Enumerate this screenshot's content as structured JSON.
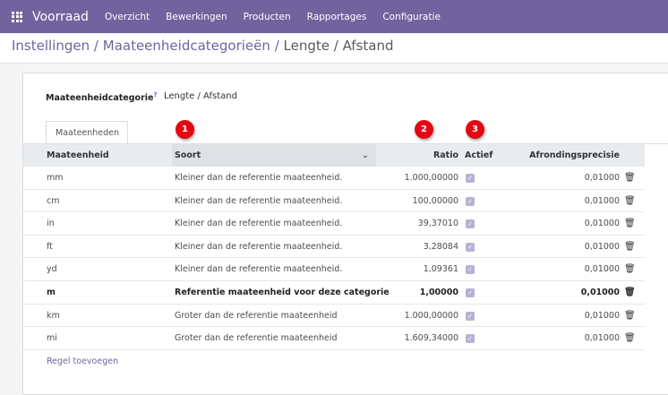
{
  "nav": {
    "brand": "Voorraad",
    "items": [
      "Overzicht",
      "Bewerkingen",
      "Producten",
      "Rapportages",
      "Configuratie"
    ]
  },
  "breadcrumb": {
    "items": [
      "Instellingen",
      "Maateenheidcategorieën"
    ],
    "current": "Lengte / Afstand",
    "separator": "/"
  },
  "form": {
    "category_label": "Maateenheidcategorie",
    "help": "?",
    "category_value": "Lengte / Afstand",
    "tab": "Maateenheden"
  },
  "table": {
    "headers": [
      "Maateenheid",
      "Soort",
      "Ratio",
      "Actief",
      "Afrondingsprecisie"
    ],
    "rows": [
      {
        "unit": "mm",
        "type": "Kleiner dan de referentie maateenheid.",
        "ratio": "1.000,00000",
        "rounding": "0,01000"
      },
      {
        "unit": "cm",
        "type": "Kleiner dan de referentie maateenheid.",
        "ratio": "100,00000",
        "rounding": "0,01000"
      },
      {
        "unit": "in",
        "type": "Kleiner dan de referentie maateenheid.",
        "ratio": "39,37010",
        "rounding": "0,01000"
      },
      {
        "unit": "ft",
        "type": "Kleiner dan de referentie maateenheid.",
        "ratio": "3,28084",
        "rounding": "0,01000"
      },
      {
        "unit": "yd",
        "type": "Kleiner dan de referentie maateenheid.",
        "ratio": "1,09361",
        "rounding": "0,01000"
      },
      {
        "unit": "m",
        "type": "Referentie maateenheid voor deze categorie",
        "ratio": "1,00000",
        "rounding": "0,01000"
      },
      {
        "unit": "km",
        "type": "Groter dan de referentie maateenheid",
        "ratio": "1.000,00000",
        "rounding": "0,01000"
      },
      {
        "unit": "mi",
        "type": "Groter dan de referentie maateenheid",
        "ratio": "1.609,34000",
        "rounding": "0,01000"
      }
    ],
    "add_line": "Regel toevoegen"
  },
  "badges": [
    "1",
    "2",
    "3"
  ],
  "colors": {
    "brand": "#71639e",
    "badge": "#e30613"
  }
}
